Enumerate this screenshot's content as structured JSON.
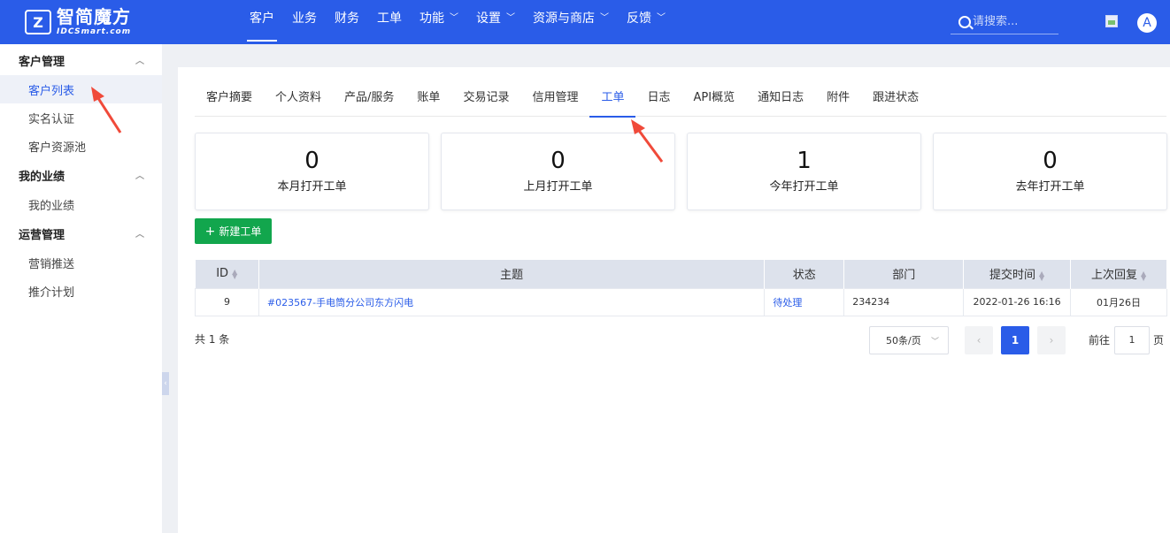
{
  "brand": {
    "name_cn": "智简魔方",
    "name_en": "IDCSmart.com"
  },
  "nav": [
    {
      "label": "客户",
      "dropdown": false,
      "active": true
    },
    {
      "label": "业务",
      "dropdown": false
    },
    {
      "label": "财务",
      "dropdown": false
    },
    {
      "label": "工单",
      "dropdown": false
    },
    {
      "label": "功能",
      "dropdown": true
    },
    {
      "label": "设置",
      "dropdown": true
    },
    {
      "label": "资源与商店",
      "dropdown": true
    },
    {
      "label": "反馈",
      "dropdown": true
    }
  ],
  "search": {
    "placeholder": "请搜索..."
  },
  "user": {
    "avatar_letter": "A"
  },
  "sidebar": {
    "groups": [
      {
        "title": "客户管理",
        "items": [
          "客户列表",
          "实名认证",
          "客户资源池"
        ]
      },
      {
        "title": "我的业绩",
        "items": [
          "我的业绩"
        ]
      },
      {
        "title": "运营管理",
        "items": [
          "营销推送",
          "推介计划"
        ]
      }
    ],
    "active_item": "客户列表"
  },
  "tabs": [
    "客户摘要",
    "个人资料",
    "产品/服务",
    "账单",
    "交易记录",
    "信用管理",
    "工单",
    "日志",
    "API概览",
    "通知日志",
    "附件",
    "跟进状态"
  ],
  "active_tab": "工单",
  "stats": [
    {
      "value": "0",
      "label": "本月打开工单"
    },
    {
      "value": "0",
      "label": "上月打开工单"
    },
    {
      "value": "1",
      "label": "今年打开工单"
    },
    {
      "value": "0",
      "label": "去年打开工单"
    }
  ],
  "new_ticket_label": "新建工单",
  "table": {
    "headers": [
      "ID",
      "主题",
      "状态",
      "部门",
      "提交时间",
      "上次回复"
    ],
    "rows": [
      {
        "id": "9",
        "subject": "#023567-手电筒分公司东方闪电",
        "status": "待处理",
        "department": "234234",
        "submitted": "2022-01-26 16:16",
        "last_reply": "01月26日"
      }
    ]
  },
  "pagination": {
    "total": "共 1 条",
    "page_size": "50条/页",
    "current_page": "1",
    "goto_label": "前往",
    "goto_value": "1",
    "goto_unit": "页"
  },
  "colors": {
    "primary": "#2a5ce8",
    "success": "#12a64d",
    "annotation": "#f04a3a"
  }
}
